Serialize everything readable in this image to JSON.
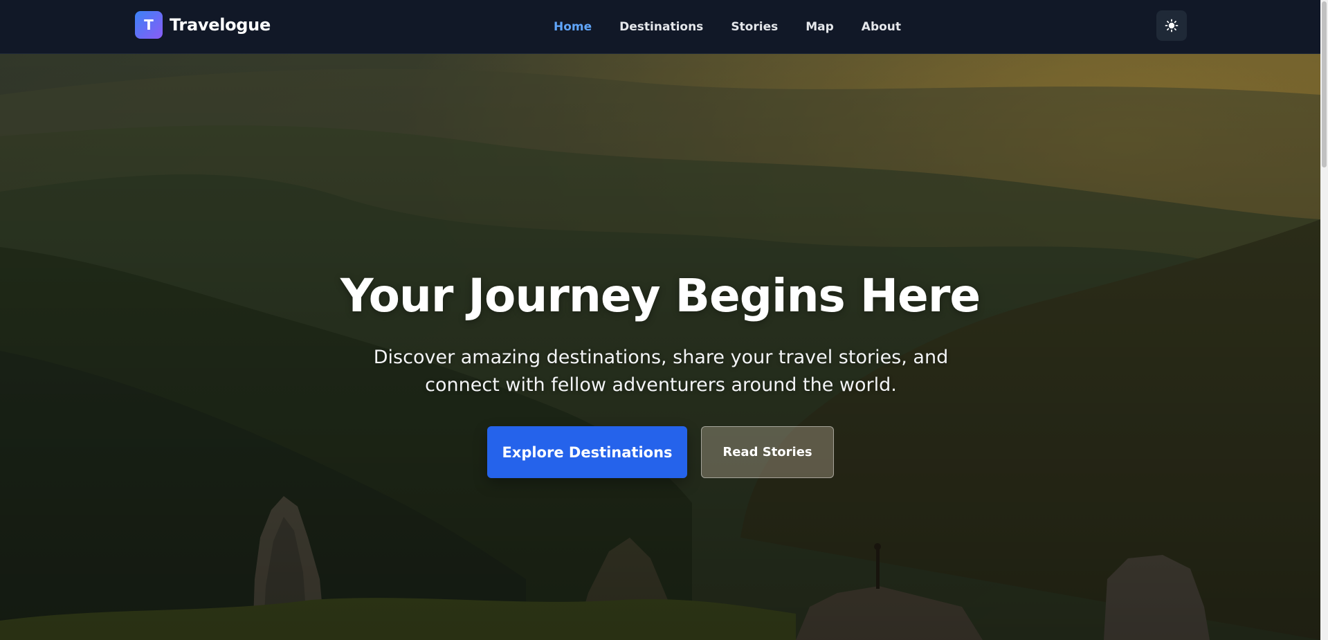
{
  "brand": {
    "logo_letter": "T",
    "name": "Travelogue"
  },
  "nav": {
    "items": [
      {
        "label": "Home",
        "active": true
      },
      {
        "label": "Destinations",
        "active": false
      },
      {
        "label": "Stories",
        "active": false
      },
      {
        "label": "Map",
        "active": false
      },
      {
        "label": "About",
        "active": false
      }
    ],
    "theme_toggle_icon": "sun-icon"
  },
  "hero": {
    "title": "Your Journey Begins Here",
    "subtitle": "Discover amazing destinations, share your travel stories, and connect with fellow adventurers around the world.",
    "primary_button": "Explore Destinations",
    "secondary_button": "Read Stories",
    "background_image": "mountain-landscape-with-hiker"
  },
  "colors": {
    "nav_bg": "#111827",
    "active_link": "#60a5fa",
    "primary_button": "#2563eb",
    "logo_gradient_start": "#3b82f6",
    "logo_gradient_end": "#8b5cf6"
  }
}
